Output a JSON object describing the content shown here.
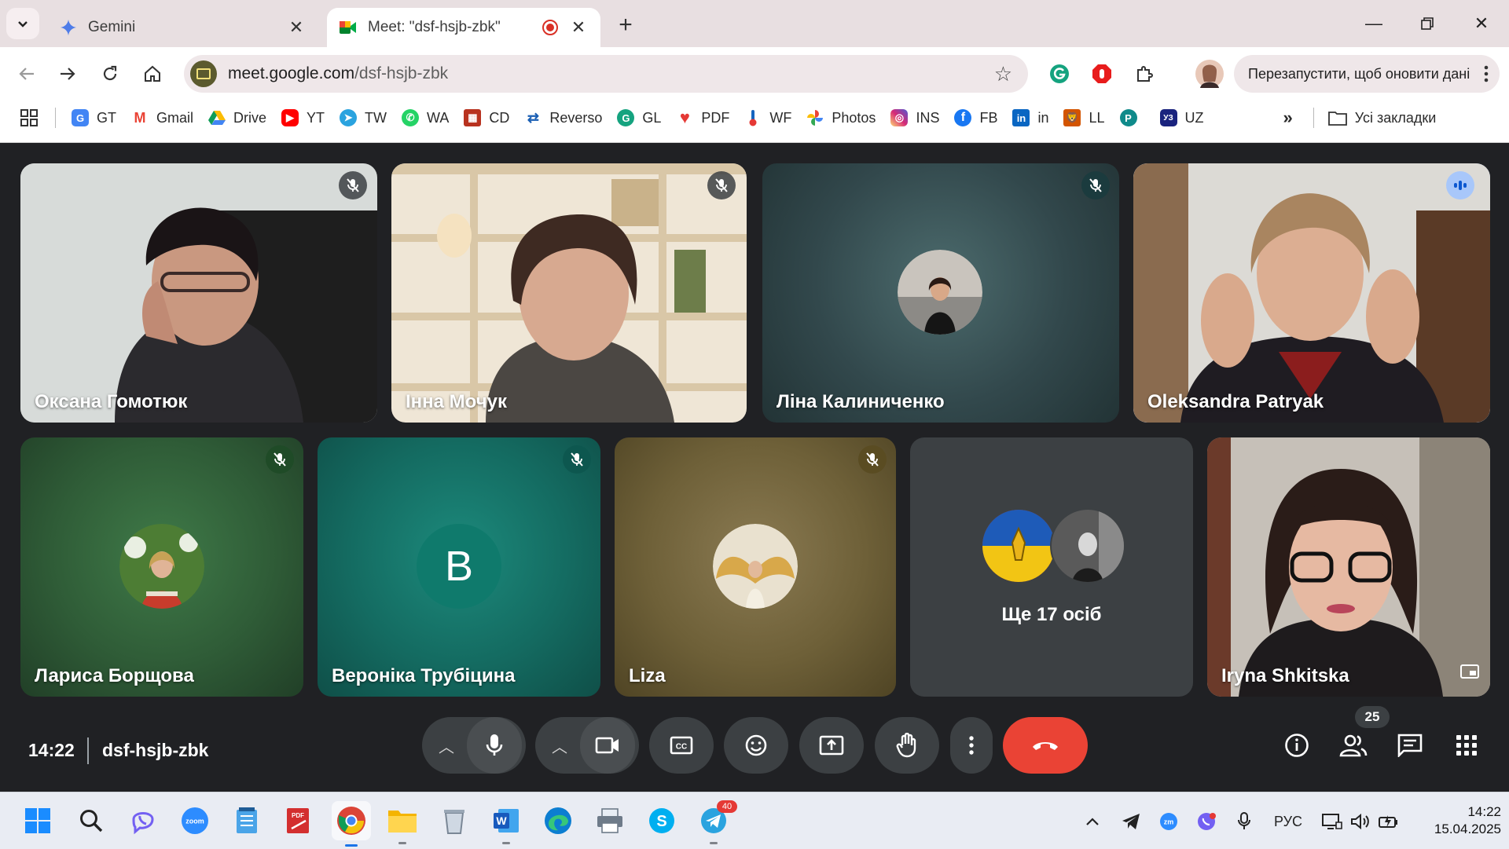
{
  "tabs": [
    {
      "title": "Gemini",
      "active": false
    },
    {
      "title": "Meet: \"dsf-hsjb-zbk\"",
      "active": true
    }
  ],
  "address": {
    "host": "meet.google.com",
    "path": "/dsf-hsjb-zbk"
  },
  "relaunch_label": "Перезапустити, щоб оновити дані",
  "bookmarks": [
    {
      "label": "GT",
      "icon": "google-translate-icon"
    },
    {
      "label": "Gmail",
      "icon": "gmail-icon"
    },
    {
      "label": "Drive",
      "icon": "drive-icon"
    },
    {
      "label": "YT",
      "icon": "youtube-icon"
    },
    {
      "label": "TW",
      "icon": "telegram-icon"
    },
    {
      "label": "WA",
      "icon": "whatsapp-icon"
    },
    {
      "label": "CD",
      "icon": "cambridge-dictionary-icon"
    },
    {
      "label": "Reverso",
      "icon": "reverso-icon"
    },
    {
      "label": "GL",
      "icon": "grammarly-icon"
    },
    {
      "label": "PDF",
      "icon": "pdf-heart-icon"
    },
    {
      "label": "WF",
      "icon": "thermometer-icon"
    },
    {
      "label": "Photos",
      "icon": "google-photos-icon"
    },
    {
      "label": "INS",
      "icon": "instagram-icon"
    },
    {
      "label": "FB",
      "icon": "facebook-icon"
    },
    {
      "label": "in",
      "icon": "linkedin-icon"
    },
    {
      "label": "LL",
      "icon": "lingualeo-icon"
    },
    {
      "label": "",
      "icon": "pinterest-icon"
    },
    {
      "label": "UZ",
      "icon": "uz-icon"
    }
  ],
  "all_bookmarks_label": "Усі закладки",
  "participants": [
    {
      "name": "Оксана Гомотюк",
      "muted": true
    },
    {
      "name": "Інна Мочук",
      "muted": true
    },
    {
      "name": "Ліна Калиниченко",
      "muted": true
    },
    {
      "name": "Oleksandra Patryak",
      "muted": false,
      "speaking": true
    },
    {
      "name": "Лариса Борщова",
      "muted": true
    },
    {
      "name": "Вероніка Трубіцина",
      "muted": true,
      "initial": "B"
    },
    {
      "name": "Liza",
      "muted": true
    },
    {
      "name": "Iryna Shkitska",
      "muted": false
    }
  ],
  "others_label": "Ще 17 осіб",
  "meeting": {
    "time": "14:22",
    "code": "dsf-hsjb-zbk",
    "participant_count": "25"
  },
  "taskbar": {
    "clock_time": "14:22",
    "clock_date": "15.04.2025",
    "language": "РУС",
    "telegram_badge": "40"
  },
  "colors": {
    "end_call": "#ea4335",
    "speaking_outline": "#a8c7fa",
    "meet_bg": "#202124"
  }
}
